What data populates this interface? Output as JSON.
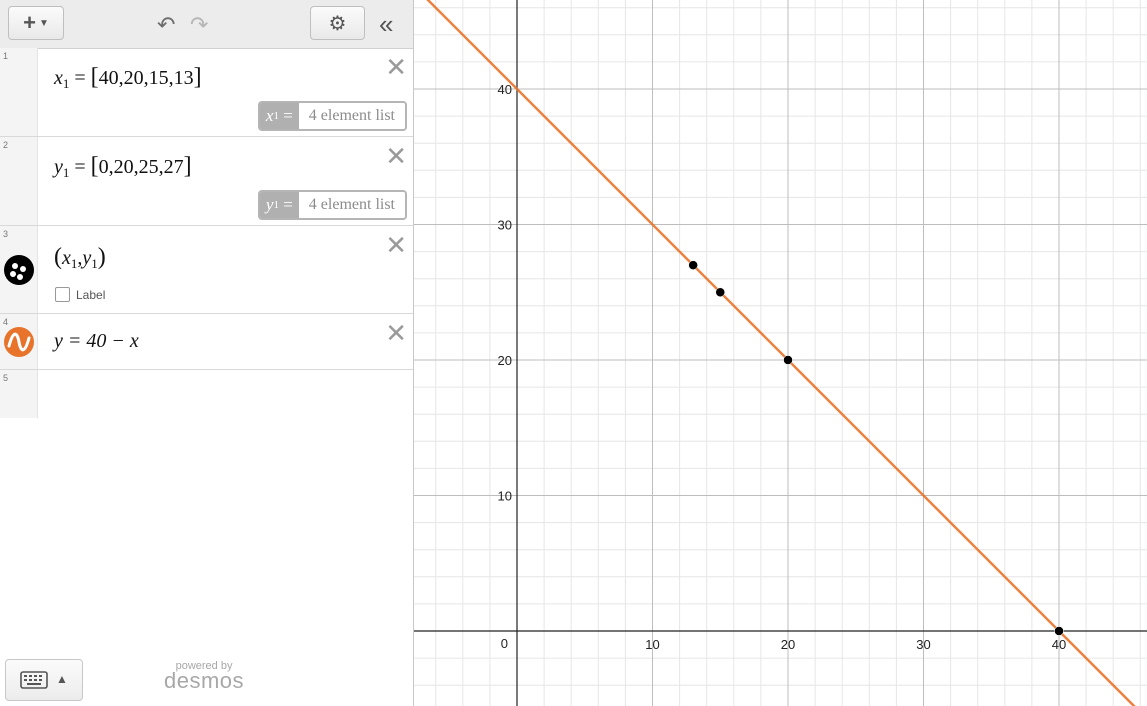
{
  "toolbar": {
    "add_icon": "plus-dropdown-icon",
    "undo_icon": "undo-icon",
    "redo_icon": "redo-icon",
    "settings_icon": "gear-icon",
    "collapse_icon": "double-chevron-left-icon"
  },
  "expressions": [
    {
      "index": "1",
      "var": "x",
      "sub": "1",
      "eq": "=",
      "list": "40,20,15,13",
      "eval_var": "x",
      "eval_sub": "1",
      "eval_eq": "=",
      "eval_text": "4 element list"
    },
    {
      "index": "2",
      "var": "y",
      "sub": "1",
      "eq": "=",
      "list": "0,20,25,27",
      "eval_var": "y",
      "eval_sub": "1",
      "eval_eq": "=",
      "eval_text": "4 element list"
    },
    {
      "index": "3",
      "px": "x",
      "psub1": "1",
      "py": "y",
      "psub2": "1",
      "label": "Label",
      "icon": "point-cluster-icon",
      "icon_color": "#000000"
    },
    {
      "index": "4",
      "text": "y = 40 − x",
      "icon": "wave-graph-icon",
      "icon_color": "#e8742c"
    },
    {
      "index": "5"
    }
  ],
  "footer": {
    "keyboard_icon": "keyboard-icon",
    "caret_icon": "caret-up-icon",
    "powered_by": "powered by",
    "brand": "desmos"
  },
  "chart_data": {
    "type": "scatter",
    "x_range": [
      -7.5,
      46.5
    ],
    "y_range": [
      -5.5,
      46.5
    ],
    "grid": true,
    "x_ticks": [
      0,
      10,
      20,
      30,
      40
    ],
    "y_ticks": [
      10,
      20,
      30,
      40
    ],
    "points": {
      "x": [
        40,
        20,
        15,
        13
      ],
      "y": [
        0,
        20,
        25,
        27
      ],
      "color": "#000000"
    },
    "line": {
      "expression": "y = 40 - x",
      "slope": -1,
      "intercept": 40,
      "color": "#e8742c"
    }
  }
}
